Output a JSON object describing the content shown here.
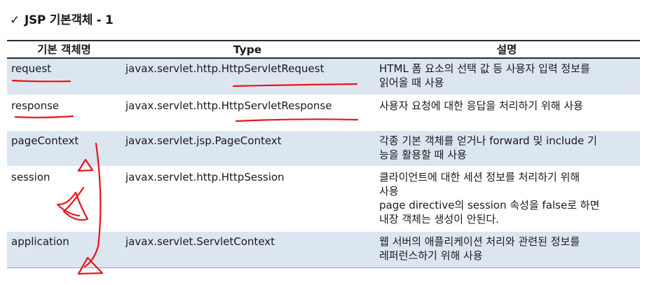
{
  "title": "JSP 기본객체 - 1",
  "check_icon": "✓",
  "table": {
    "headers": [
      "기본 객체명",
      "Type",
      "설명"
    ],
    "rows": [
      {
        "name": "request",
        "type": "javax.servlet.http.HttpServletRequest",
        "desc": [
          "HTML 폼 요소의 선택 값 등 사용자 입력 정보를",
          "읽어올 때 사용"
        ]
      },
      {
        "name": "response",
        "type": "javax.servlet.http.HttpServletResponse",
        "desc": [
          "사용자 요청에 대한 응답을 처리하기 위해 사용"
        ]
      },
      {
        "name": "pageContext",
        "type": "javax.servlet.jsp.PageContext",
        "desc": [
          "각종 기본 객체를 얻거나 forward 및 include 기",
          "능을 활용할 때 사용"
        ]
      },
      {
        "name": "session",
        "type": "javax.servlet.http.HttpSession",
        "desc": [
          "클라이언트에 대한 세션 정보를 처리하기 위해",
          "사용",
          "page directive의 session 속성을 false로 하면",
          "내장 객체는 생성이 안된다."
        ]
      },
      {
        "name": "application",
        "type": "javax.servlet.ServletContext",
        "desc": [
          "웹 서버의 애플리케이션 처리와 관련된 정보를",
          "레퍼런스하기 위해 사용"
        ]
      }
    ]
  },
  "colors": {
    "row_shade": "#dce6f1",
    "rule": "#2b2b2b",
    "annotation_ink": "#e8141b"
  }
}
